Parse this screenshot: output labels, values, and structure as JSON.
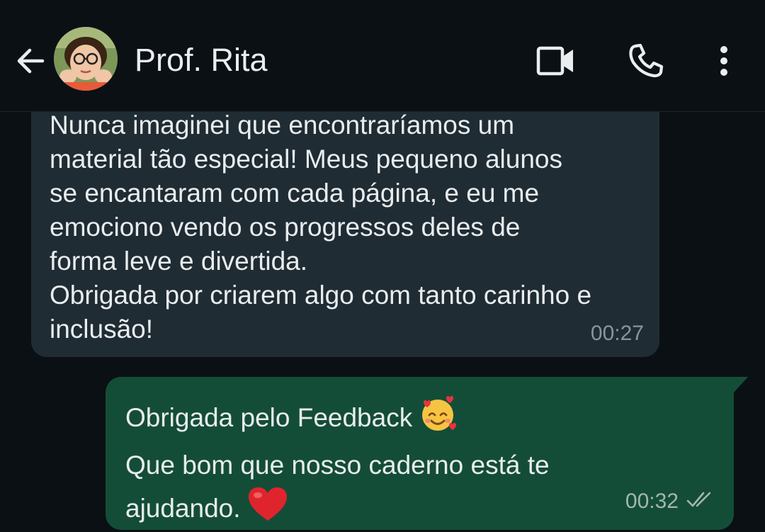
{
  "header": {
    "contact_name": "Prof. Rita",
    "icons": [
      "arrow-left-icon",
      "avatar",
      "video-camera-icon",
      "phone-icon",
      "more-vertical-icon"
    ]
  },
  "messages": {
    "incoming": {
      "text": "Nunca imaginei que encontraríamos um\nmaterial tão especial! Meus pequeno alunos\nse encantaram com cada página, e eu me\nemociono vendo os progressos deles de\nforma leve e divertida.\nObrigada por criarem algo com tanto carinho e\ninclusão!",
      "time": "00:27"
    },
    "outgoing": {
      "line1": "Obrigada pelo Feedback",
      "line2": "Que bom que nosso caderno está te",
      "line3": "ajudando.",
      "time": "00:32",
      "status": "read"
    }
  },
  "colors": {
    "background": "#0b1014",
    "incoming_bubble": "#202c33",
    "outgoing_bubble": "#144d37",
    "text": "#e9edef",
    "timestamp": "#8696a0"
  }
}
